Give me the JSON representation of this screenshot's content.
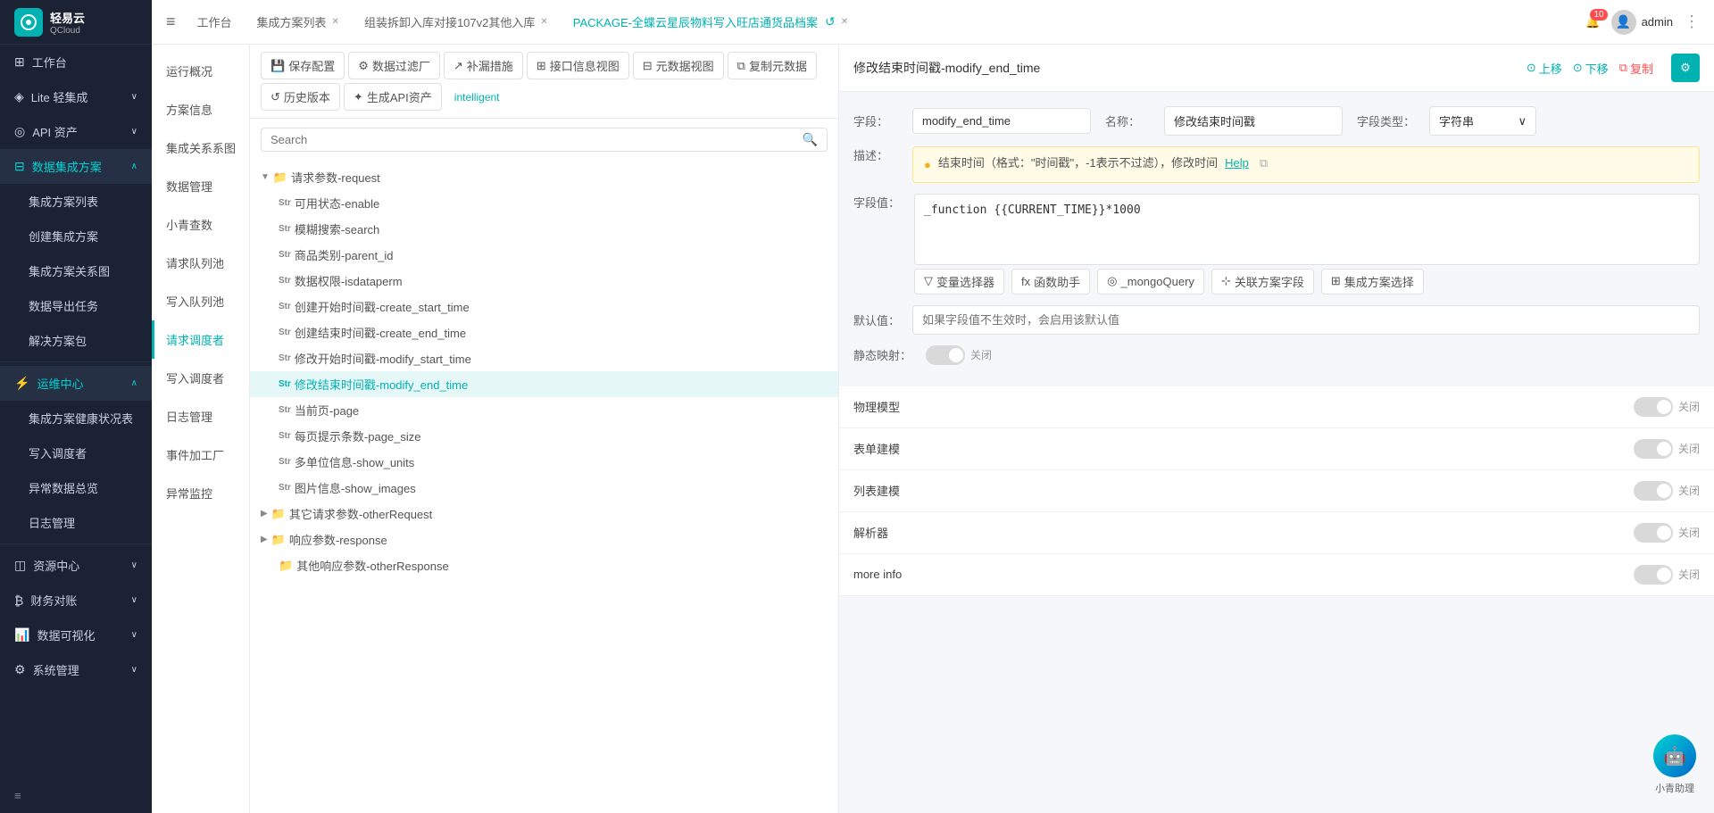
{
  "app": {
    "logo_text": "轻易云",
    "logo_sub": "QCloud",
    "collapse_icon": "≡"
  },
  "sidebar": {
    "items": [
      {
        "id": "workspace",
        "label": "工作台",
        "icon": "⊞",
        "expandable": false
      },
      {
        "id": "lite",
        "label": "Lite 轻集成",
        "icon": "◈",
        "expandable": true
      },
      {
        "id": "api",
        "label": "API 资产",
        "icon": "◎",
        "expandable": true
      },
      {
        "id": "data-solution",
        "label": "数据集成方案",
        "icon": "⊟",
        "expandable": true,
        "active": true
      },
      {
        "id": "solution-list",
        "label": "集成方案列表",
        "sub": true,
        "active": false
      },
      {
        "id": "create-solution",
        "label": "创建集成方案",
        "sub": true
      },
      {
        "id": "solution-relations",
        "label": "集成方案关系图",
        "sub": true
      },
      {
        "id": "data-export",
        "label": "数据导出任务",
        "sub": true
      },
      {
        "id": "solution-package",
        "label": "解决方案包",
        "sub": true
      },
      {
        "id": "ops",
        "label": "运维中心",
        "icon": "⚡",
        "expandable": true,
        "active": true
      },
      {
        "id": "solution-health",
        "label": "集成方案健康状况表",
        "sub": true
      },
      {
        "id": "write-in",
        "label": "写入调度者",
        "sub": true
      },
      {
        "id": "anomaly",
        "label": "异常数据总览",
        "sub": true
      },
      {
        "id": "log",
        "label": "日志管理",
        "sub": true
      },
      {
        "id": "resource",
        "label": "资源中心",
        "icon": "◫",
        "expandable": true
      },
      {
        "id": "finance",
        "label": "财务对账",
        "icon": "₿",
        "expandable": true
      },
      {
        "id": "dataviz",
        "label": "数据可视化",
        "icon": "📊",
        "expandable": true
      },
      {
        "id": "sysadmin",
        "label": "系统管理",
        "icon": "⚙",
        "expandable": true
      }
    ]
  },
  "tabs": [
    {
      "id": "workspace-tab",
      "label": "工作台",
      "closable": false,
      "active": false
    },
    {
      "id": "solution-list-tab",
      "label": "集成方案列表",
      "closable": true,
      "active": false
    },
    {
      "id": "unpack-tab",
      "label": "组装拆卸入库对接107v2其他入库",
      "closable": true,
      "active": false
    },
    {
      "id": "package-tab",
      "label": "PACKAGE-全蝶云星辰物料写入旺店通货品档案",
      "closable": true,
      "active": true
    }
  ],
  "topbar": {
    "notification_count": "10",
    "username": "admin",
    "more_icon": "⋮"
  },
  "left_nav": {
    "items": [
      {
        "id": "overview",
        "label": "运行概况"
      },
      {
        "id": "plan-info",
        "label": "方案信息"
      },
      {
        "id": "integration-map",
        "label": "集成关系系图"
      },
      {
        "id": "data-mgmt",
        "label": "数据管理"
      },
      {
        "id": "xiao-qing",
        "label": "小青查数"
      },
      {
        "id": "request-queue",
        "label": "请求队列池"
      },
      {
        "id": "write-queue",
        "label": "写入队列池"
      },
      {
        "id": "request-debugger",
        "label": "请求调度者",
        "active": true
      },
      {
        "id": "write-in-debugger",
        "label": "写入调度者"
      },
      {
        "id": "log-mgmt",
        "label": "日志管理"
      },
      {
        "id": "event-factory",
        "label": "事件加工厂"
      },
      {
        "id": "anomaly-monitor",
        "label": "异常监控"
      }
    ]
  },
  "toolbar": {
    "save_config": "保存配置",
    "data_filter": "数据过滤厂",
    "patch_measure": "补漏措施",
    "interface_info": "接口信息视图",
    "meta_data_view": "元数据视图",
    "copy_data": "复制元数据",
    "history": "历史版本",
    "gen_api": "生成API资产",
    "intelligent": "intelligent"
  },
  "search": {
    "placeholder": "Search"
  },
  "tree": {
    "nodes": [
      {
        "id": "request-params",
        "label": "请求参数-request",
        "type": "folder",
        "expanded": true,
        "level": 0
      },
      {
        "id": "enable",
        "label": "可用状态-enable",
        "type": "str",
        "level": 1
      },
      {
        "id": "search",
        "label": "模糊搜索-search",
        "type": "str",
        "level": 1
      },
      {
        "id": "parent-id",
        "label": "商品类别-parent_id",
        "type": "str",
        "level": 1
      },
      {
        "id": "isdataperm",
        "label": "数据权限-isdataperm",
        "type": "str",
        "level": 1
      },
      {
        "id": "create-start",
        "label": "创建开始时间戳-create_start_time",
        "type": "str",
        "level": 1
      },
      {
        "id": "create-end",
        "label": "创建结束时间戳-create_end_time",
        "type": "str",
        "level": 1
      },
      {
        "id": "modify-start",
        "label": "修改开始时间戳-modify_start_time",
        "type": "str",
        "level": 1
      },
      {
        "id": "modify-end",
        "label": "修改结束时间戳-modify_end_time",
        "type": "str",
        "level": 1,
        "selected": true
      },
      {
        "id": "page",
        "label": "当前页-page",
        "type": "str",
        "level": 1
      },
      {
        "id": "page-size",
        "label": "每页提示条数-page_size",
        "type": "str",
        "level": 1
      },
      {
        "id": "show-units",
        "label": "多单位信息-show_units",
        "type": "str",
        "level": 1
      },
      {
        "id": "show-images",
        "label": "图片信息-show_images",
        "type": "str",
        "level": 1
      },
      {
        "id": "other-request",
        "label": "其它请求参数-otherRequest",
        "type": "folder",
        "level": 0,
        "expanded": false
      },
      {
        "id": "response",
        "label": "响应参数-response",
        "type": "folder",
        "level": 0,
        "expanded": false
      },
      {
        "id": "other-response",
        "label": "其他响应参数-otherResponse",
        "type": "folder",
        "level": 0,
        "expanded": false
      }
    ]
  },
  "detail": {
    "title": "修改结束时间戳-modify_end_time",
    "actions": {
      "up": "上移",
      "down": "下移",
      "copy": "复制"
    },
    "field_label": "字段：",
    "field_value": "modify_end_time",
    "name_label": "名称：",
    "name_value": "修改结束时间戳",
    "type_label": "字段类型：",
    "type_value": "字符串",
    "desc_label": "描述：",
    "desc_text": "结束时间（格式：\"时间戳\"，-1表示不过滤），修改时间",
    "desc_help": "Help",
    "field_value_label": "字段值：",
    "field_value_code": "_function {{CURRENT_TIME}}*1000",
    "buttons": {
      "var_selector": "变量选择器",
      "func_helper": "函数助手",
      "mongo_query": "_mongoQuery",
      "rel_field": "关联方案字段",
      "solution_select": "集成方案选择"
    },
    "default_label": "默认值：",
    "default_placeholder": "如果字段值不生效时，会启用该默认值",
    "static_map_label": "静态映射：",
    "static_map_value": "关闭",
    "sections": [
      {
        "id": "physical-model",
        "label": "物理模型",
        "toggle": "关闭"
      },
      {
        "id": "form-build",
        "label": "表单建模",
        "toggle": "关闭"
      },
      {
        "id": "list-build",
        "label": "列表建模",
        "toggle": "关闭"
      },
      {
        "id": "parser",
        "label": "解析器",
        "toggle": "关闭"
      },
      {
        "id": "more-info",
        "label": "more info",
        "toggle": "关闭"
      }
    ]
  },
  "colors": {
    "primary": "#00b2b2",
    "active_bg": "#e6f7f7",
    "selected_tree": "#00b2b2",
    "warning": "#faad14",
    "danger": "#ff4d4f"
  }
}
